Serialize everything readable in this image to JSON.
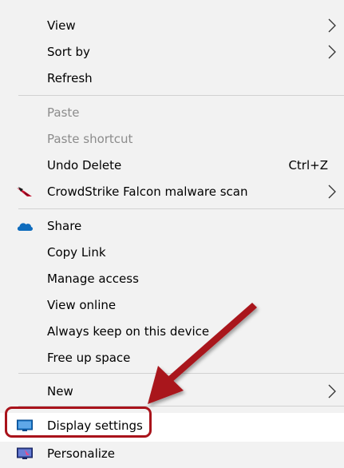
{
  "menu": {
    "items": [
      {
        "label": "View",
        "submenu": true
      },
      {
        "label": "Sort by",
        "submenu": true
      },
      {
        "label": "Refresh"
      },
      {
        "label": "Paste",
        "disabled": true
      },
      {
        "label": "Paste shortcut",
        "disabled": true
      },
      {
        "label": "Undo Delete",
        "shortcut": "Ctrl+Z"
      },
      {
        "label": "CrowdStrike Falcon malware scan",
        "submenu": true,
        "icon": "falcon-icon"
      },
      {
        "label": "Share",
        "icon": "onedrive-cloud-icon"
      },
      {
        "label": "Copy Link"
      },
      {
        "label": "Manage access"
      },
      {
        "label": "View online"
      },
      {
        "label": "Always keep on this device"
      },
      {
        "label": "Free up space"
      },
      {
        "label": "New",
        "submenu": true
      },
      {
        "label": "Display settings",
        "icon": "display-monitor-icon",
        "highlighted": true
      },
      {
        "label": "Personalize",
        "icon": "personalize-icon"
      }
    ]
  },
  "colors": {
    "menu_bg": "#f2f2f2",
    "disabled_text": "#8c8c8c",
    "separator": "#d2d2d2",
    "annotation_red": "#a9131b",
    "onedrive_blue": "#0f6cbd"
  }
}
